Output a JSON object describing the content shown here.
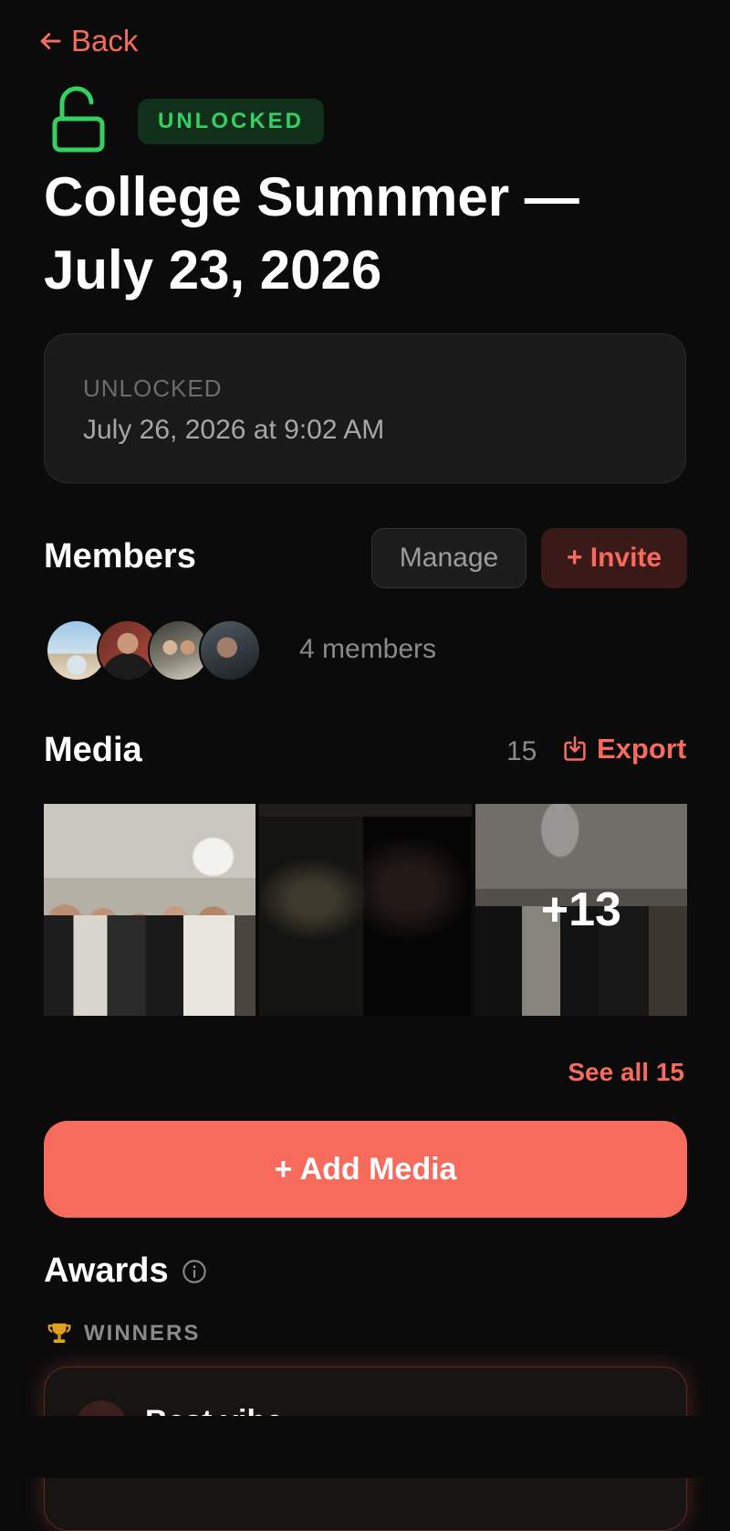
{
  "nav": {
    "back_label": "Back"
  },
  "status_badge": "UNLOCKED",
  "title": "College Sumnmer — July 23, 2026",
  "info": {
    "label": "UNLOCKED",
    "value": "July 26, 2026 at 9:02 AM"
  },
  "members": {
    "heading": "Members",
    "manage_label": "Manage",
    "invite_label": "+ Invite",
    "count_text": "4 members",
    "avatars": 4
  },
  "media": {
    "heading": "Media",
    "count": "15",
    "export_label": "Export",
    "more_overlay": "+13",
    "see_all_label": "See all 15",
    "add_label": "+ Add Media"
  },
  "awards": {
    "heading": "Awards",
    "winners_label": "WINNERS",
    "first_award_title": "Best vibe"
  },
  "colors": {
    "accent": "#f76b5c",
    "success": "#33d162",
    "background": "#0b0b0b"
  }
}
